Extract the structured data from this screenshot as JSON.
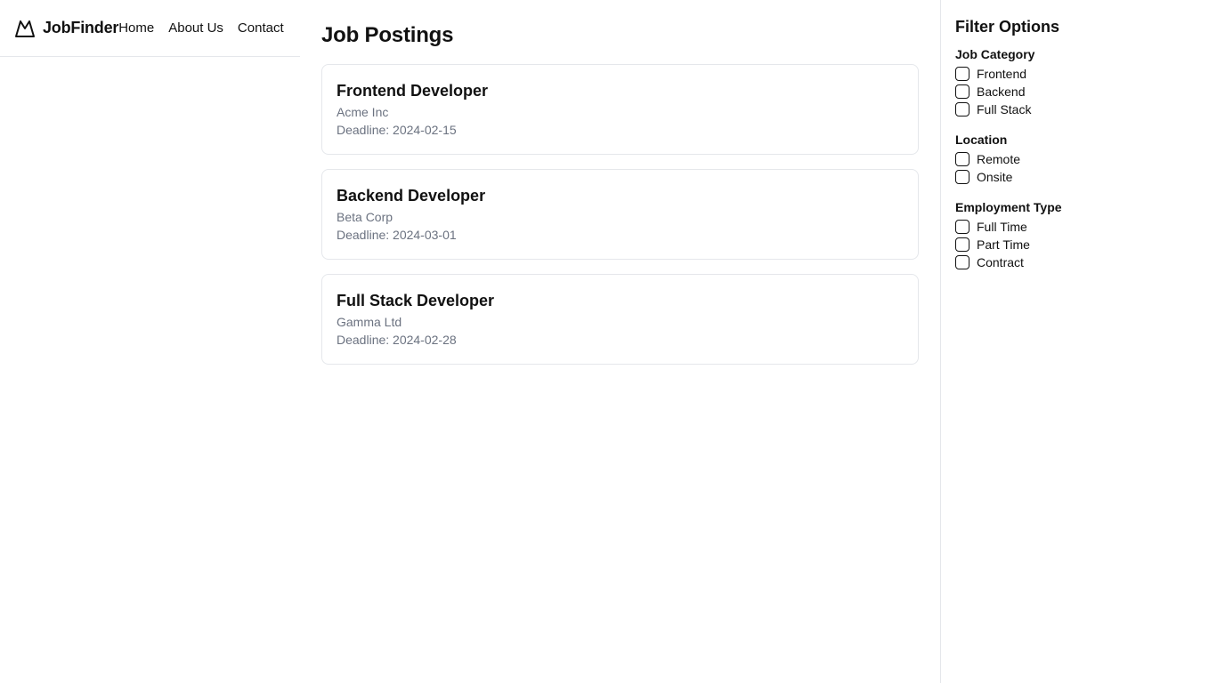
{
  "header": {
    "brand": "JobFinder",
    "brand_icon": "mountain-icon",
    "nav": [
      "Home",
      "About Us",
      "Contact"
    ]
  },
  "main": {
    "title": "Job Postings",
    "jobs": [
      {
        "title": "Frontend Developer",
        "company": "Acme Inc",
        "deadline": "Deadline: 2024-02-15"
      },
      {
        "title": "Backend Developer",
        "company": "Beta Corp",
        "deadline": "Deadline: 2024-03-01"
      },
      {
        "title": "Full Stack Developer",
        "company": "Gamma Ltd",
        "deadline": "Deadline: 2024-02-28"
      }
    ]
  },
  "sidebar": {
    "title": "Filter Options",
    "groups": [
      {
        "title": "Job Category",
        "options": [
          "Frontend",
          "Backend",
          "Full Stack"
        ]
      },
      {
        "title": "Location",
        "options": [
          "Remote",
          "Onsite"
        ]
      },
      {
        "title": "Employment Type",
        "options": [
          "Full Time",
          "Part Time",
          "Contract"
        ]
      }
    ]
  },
  "colors": {
    "text": "#111111",
    "muted": "#6b7280",
    "border": "#e5e7eb"
  }
}
